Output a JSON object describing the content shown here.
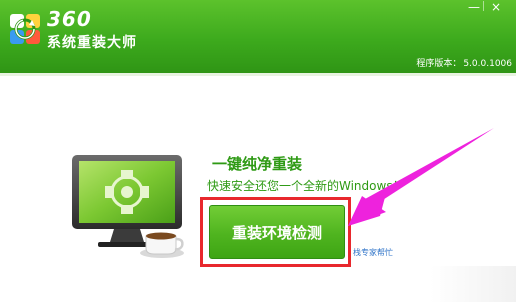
{
  "app": {
    "brand_number": "360",
    "brand_name": "系统重装大师",
    "version_label": "程序版本：",
    "version_value": "5.0.0.1006"
  },
  "main": {
    "title": "一键纯净重装",
    "subtitle": "快速安全还您一个全新的Windows！",
    "primary_button": "重装环境检测",
    "help_link": "栈专家帮忙"
  },
  "window_controls": {
    "minimize": "—",
    "close": "×"
  },
  "colors": {
    "header_green": "#3daa1d",
    "accent_green": "#2e9a14",
    "highlight_red": "#e8282d",
    "arrow_magenta": "#ee22dd"
  },
  "icons": {
    "logo": "360-logo-icon",
    "illustration": "monitor-with-coffee-icon",
    "arrow": "annotation-arrow-icon"
  }
}
